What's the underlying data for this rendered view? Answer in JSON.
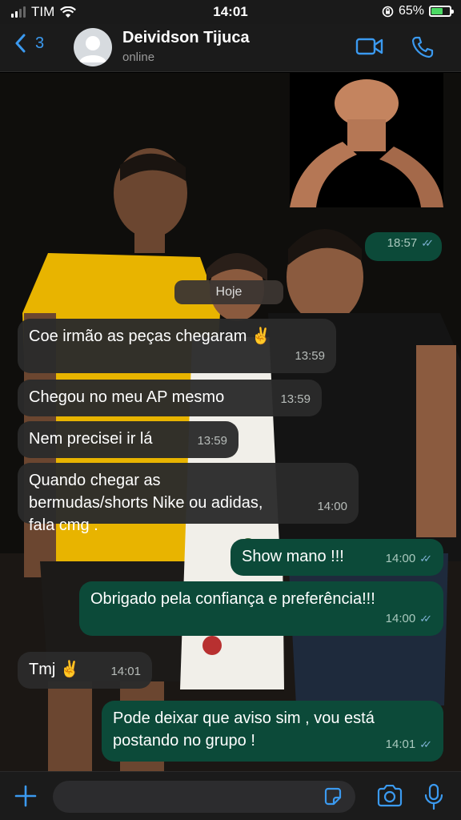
{
  "status_bar": {
    "carrier": "TIM",
    "time": "14:01",
    "battery_percent": "65%",
    "battery_level": 0.65
  },
  "header": {
    "back_count": "3",
    "contact_name": "Deividson Tijuca",
    "contact_status": "online"
  },
  "chat": {
    "date_divider": "Hoje",
    "image_message": {
      "time": "18:57"
    },
    "messages": [
      {
        "direction": "in",
        "text": "Coe irmão as peças chegaram ✌️",
        "time": "13:59"
      },
      {
        "direction": "in",
        "text": "Chegou no meu AP mesmo",
        "time": "13:59"
      },
      {
        "direction": "in",
        "text": "Nem precisei ir lá",
        "time": "13:59"
      },
      {
        "direction": "in",
        "text": "Quando chegar as bermudas/shorts Nike ou adidas, fala cmg .",
        "time": "14:00"
      },
      {
        "direction": "out",
        "text": "Show mano !!!",
        "time": "14:00"
      },
      {
        "direction": "out",
        "text": "Obrigado pela confiança e preferência!!!",
        "time": "14:00"
      },
      {
        "direction": "in",
        "text": "Tmj ✌️",
        "time": "14:01"
      },
      {
        "direction": "out",
        "text": "Pode deixar que aviso sim , vou está postando no grupo !",
        "time": "14:01"
      }
    ]
  },
  "input": {
    "placeholder": ""
  },
  "colors": {
    "accent": "#3b9af0",
    "outgoing_bubble": "#0c4a39",
    "incoming_bubble": "#2b2b2b",
    "read_ticks": "#7fb3d5"
  },
  "icons": {
    "back": "chevron-left-icon",
    "video": "video-camera-icon",
    "call": "phone-icon",
    "attach": "plus-icon",
    "sticker": "sticker-icon",
    "camera": "camera-icon",
    "mic": "microphone-icon"
  }
}
